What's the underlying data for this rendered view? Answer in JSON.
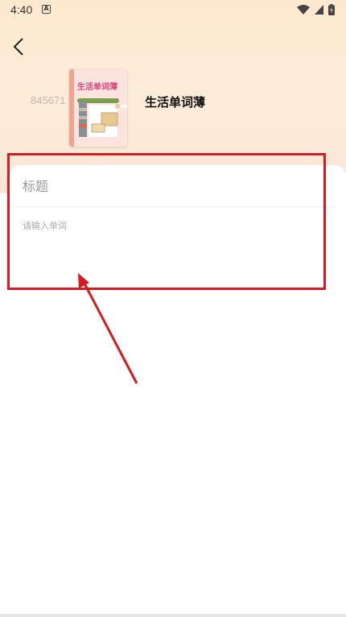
{
  "status_bar": {
    "time": "4:40",
    "notification_icon": "A"
  },
  "nav": {
    "back_icon": "chevron-left-icon"
  },
  "book": {
    "cover_title": "生活单词薄",
    "id_text": "845671",
    "name": "生活单词薄"
  },
  "form": {
    "title_placeholder": "标题",
    "word_placeholder": "请输入单词"
  },
  "colors": {
    "highlight": "#d51c22",
    "header_bg": "#fde9cf",
    "cover_title": "#e0417a"
  }
}
